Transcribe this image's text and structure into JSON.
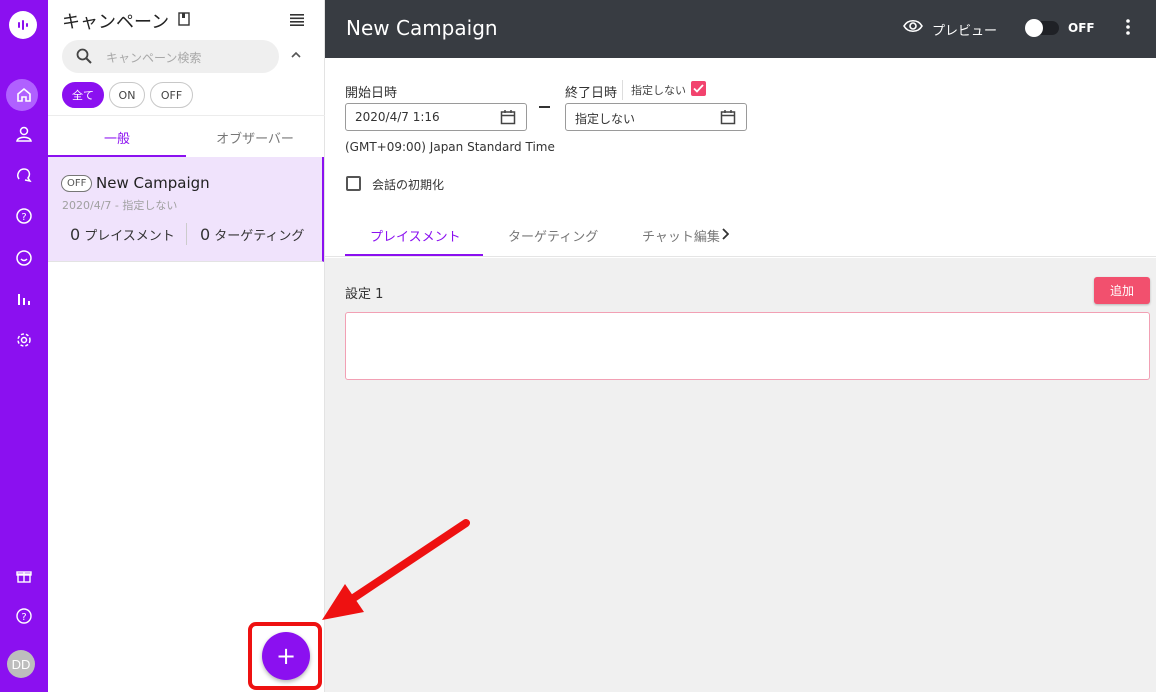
{
  "rail": {
    "icons": [
      "logo-icon",
      "home-icon",
      "user-icon",
      "chat-bubble-icon",
      "help-bubble-icon",
      "chat-smile-icon",
      "bar-chart-icon",
      "gear-icon",
      "gift-icon",
      "help-circle-icon"
    ],
    "avatar_initials": "DD"
  },
  "list": {
    "title": "キャンペーン",
    "search_placeholder": "キャンペーン検索",
    "filters": [
      "全て",
      "ON",
      "OFF"
    ],
    "tabs": [
      "一般",
      "オブザーバー"
    ],
    "campaign": {
      "status": "OFF",
      "name": "New Campaign",
      "date": "2020/4/7 - 指定しない",
      "placement_count": "0",
      "placement_label": "プレイスメント",
      "targeting_count": "0",
      "targeting_label": "ターゲティング"
    },
    "add_label": "+"
  },
  "header": {
    "title": "New Campaign",
    "preview_label": "プレビュー",
    "toggle_label": "OFF"
  },
  "form": {
    "start_label": "開始日時",
    "start_value": "2020/4/7 1:16",
    "end_label": "終了日時",
    "no_setting_label": "指定しない",
    "end_value": "指定しない",
    "timezone": "(GMT+09:00) Japan Standard Time",
    "reset_conversation_label": "会話の初期化",
    "tabs": [
      "プレイスメント",
      "ターゲティング",
      "チャット編集"
    ]
  },
  "content": {
    "setting_title": "設定 1",
    "add_button": "追加"
  },
  "colors": {
    "accent": "#8b10f0",
    "header_bg": "#383c42",
    "pink": "#f2506e",
    "annotation_red": "#ee1111"
  }
}
